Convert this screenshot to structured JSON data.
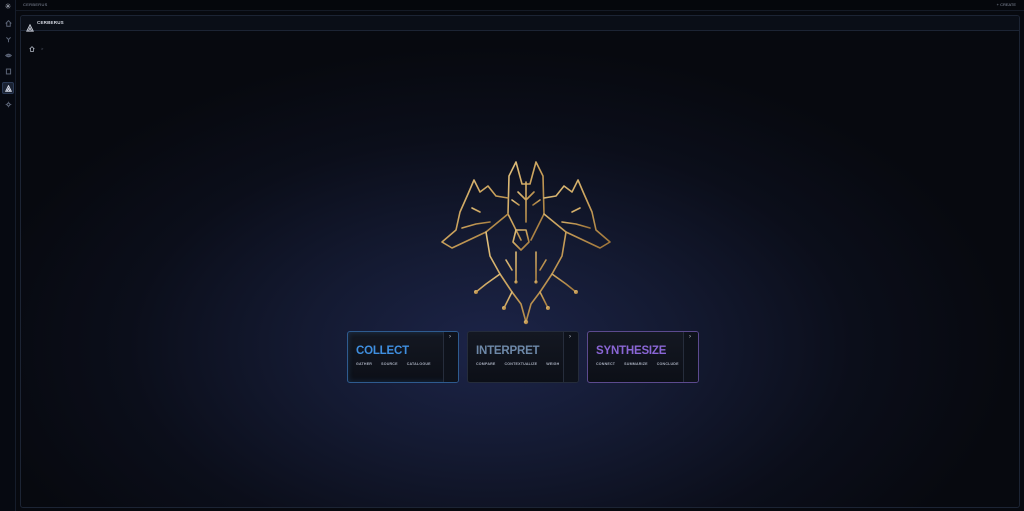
{
  "topbar": {
    "title": "CERBERUS",
    "right_label": "+ CREATE"
  },
  "window": {
    "title": "CERBERUS",
    "breadcrumb_sep": ">"
  },
  "sidebar": {
    "items": [
      "home",
      "graph",
      "eye",
      "document",
      "cerberus",
      "settings"
    ],
    "active": "cerberus"
  },
  "cards": [
    {
      "name": "COLLECT",
      "tags": [
        "GATHER",
        "SOURCE",
        "CATALOGUE"
      ],
      "color": "#3f8fe0"
    },
    {
      "name": "INTERPRET",
      "tags": [
        "COMPARE",
        "CONTEXTUALIZE",
        "WEIGH"
      ],
      "color": "#6d88a8"
    },
    {
      "name": "SYNTHESIZE",
      "tags": [
        "CONNECT",
        "SUMMARIZE",
        "CONCLUDE"
      ],
      "color": "#8a66d6"
    }
  ],
  "colors": {
    "accent_gold": "#c9a05a",
    "accent_blue": "#3f8fe0",
    "accent_purple": "#8a66d6"
  }
}
